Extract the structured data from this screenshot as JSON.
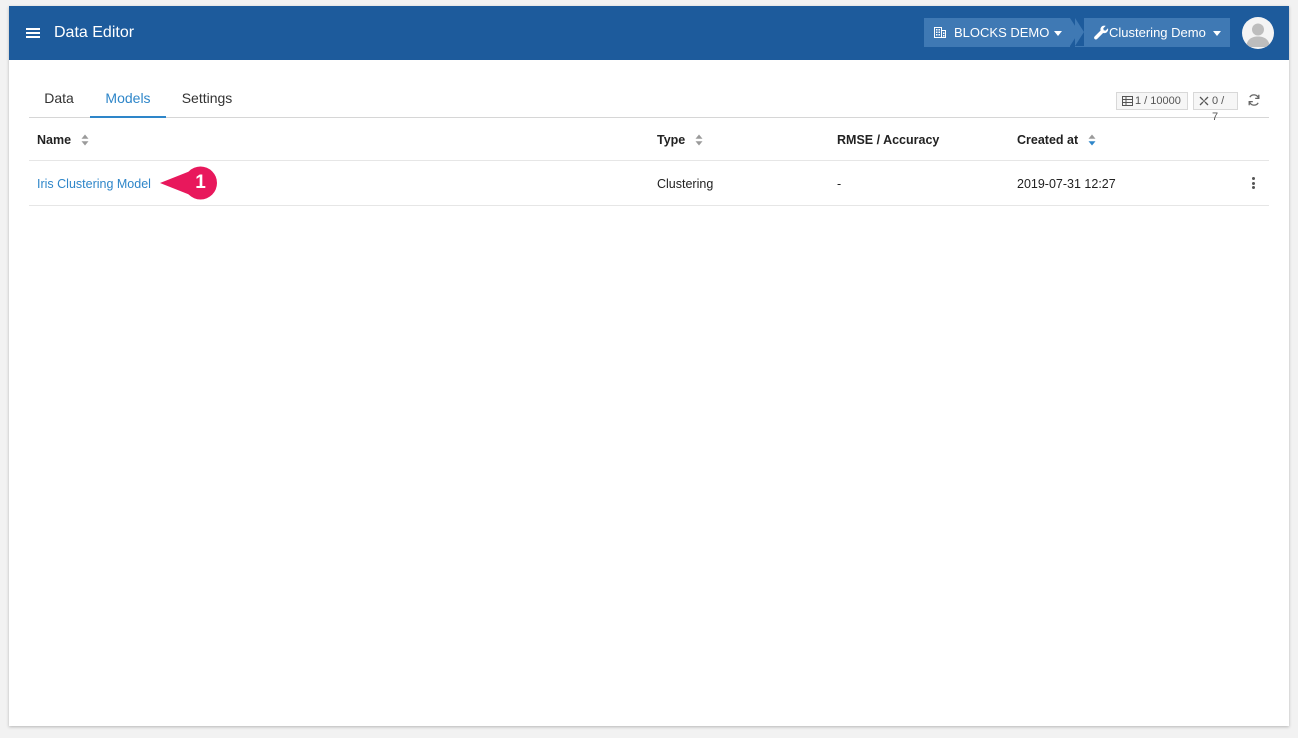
{
  "appbar": {
    "title": "Data Editor",
    "organization": "BLOCKS DEMO",
    "project": "Clustering Demo",
    "background_color": "#1d5b9c",
    "icons": [
      "menu-icon",
      "building-icon",
      "wrench-icon",
      "user-avatar-icon"
    ]
  },
  "tabs": [
    {
      "label": "Data",
      "active": false
    },
    {
      "label": "Models",
      "active": true
    },
    {
      "label": "Settings",
      "active": false
    }
  ],
  "counters": {
    "rows": "1 / 10000",
    "columns": "0 / 7"
  },
  "table": {
    "columns": [
      "Name",
      "Type",
      "RMSE / Accuracy",
      "Created at"
    ],
    "sorted_column": "Created at",
    "rows": [
      {
        "name": "Iris Clustering Model",
        "type": "Clustering",
        "metric": "-",
        "created_at": "2019-07-31 12:27"
      }
    ]
  },
  "callout": {
    "number": "1",
    "color": "#e8185c"
  },
  "accent_color": "#2e86c9"
}
